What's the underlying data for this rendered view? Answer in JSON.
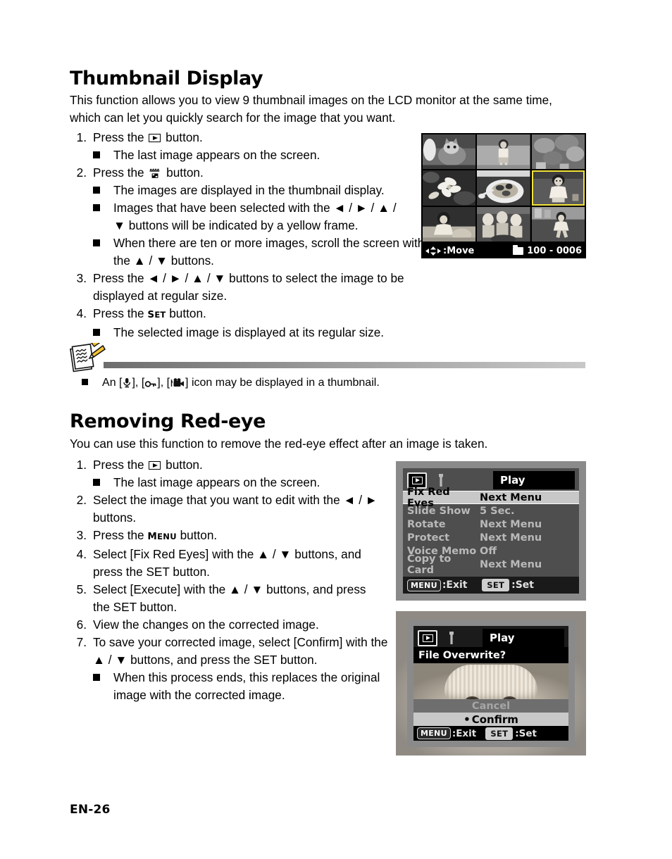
{
  "page": {
    "footer_label": "EN-26"
  },
  "section1": {
    "heading": "Thumbnail Display",
    "intro": "This function allows you to view 9 thumbnail images on the LCD monitor at the same time, which can let you quickly search for the image that you want.",
    "steps": [
      {
        "num": "1.",
        "pre": "Press the",
        "icon": "play-button-icon",
        "post": "button."
      },
      {
        "num": "2.",
        "pre": "Press the",
        "icon": "thumbnail-button-icon",
        "post": "button."
      },
      {
        "num": "3.",
        "text": "Press the ◄ / ► / ▲ / ▼ buttons to select the image to be displayed at regular size."
      },
      {
        "num": "4.",
        "pre": "Press the",
        "icon": "set-button-icon",
        "post": "button."
      }
    ],
    "bullets": {
      "b1": "The last image appears on the screen.",
      "b2": "The images are displayed in the thumbnail display.",
      "b3": "Images that have been selected with the ◄ / ► / ▲ / ▼ buttons will be indicated by a yellow frame.",
      "b4": "When there are ten or more images, scroll the screen with the ▲ / ▼ buttons.",
      "b5": "The selected image is displayed at its regular size."
    }
  },
  "note": {
    "text_before": "An [",
    "text_mid1": "], [",
    "text_mid2": "], [",
    "text_after": "] icon may be displayed in a thumbnail.",
    "icons": [
      "microphone-icon",
      "key-lock-icon",
      "video-camera-icon"
    ],
    "full_text": "An [mic], [key], [video] icon may be displayed in a thumbnail."
  },
  "section2": {
    "heading": "Removing Red-eye",
    "intro": "You can use this function to remove the red-eye effect after an image is taken.",
    "steps": [
      {
        "num": "1.",
        "pre": "Press the",
        "icon": "play-button-icon",
        "post": "button."
      },
      {
        "num": "2.",
        "text": "Select the image that you want to edit with the ◄ / ► buttons."
      },
      {
        "num": "3.",
        "pre": "Press the",
        "icon": "menu-button-icon",
        "post": "button."
      },
      {
        "num": "4.",
        "text": "Select [Fix Red Eyes] with the ▲ / ▼ buttons, and press the SET button."
      },
      {
        "num": "5.",
        "text": "Select [Execute] with the ▲ / ▼ buttons, and press the SET button."
      },
      {
        "num": "6.",
        "text": "View the changes on the corrected image."
      },
      {
        "num": "7.",
        "text": "To save your corrected image, select [Confirm] with the ▲ / ▼ buttons, and press the SET button."
      }
    ],
    "bullets": {
      "b1": "The last image appears on the screen.",
      "b2": "When this process ends, this replaces the original image with the corrected image."
    }
  },
  "thumbnail_screen": {
    "move_label": ":Move",
    "file_number": "100 - 0006",
    "selected_index": 5,
    "cells": [
      "cat-photo",
      "girl-standing-photo",
      "plants-photo",
      "flowers-photo",
      "food-plate-photo",
      "child-on-grass-photo",
      "girl-sitting-photo",
      "children-group-photo",
      "boy-running-photo"
    ]
  },
  "play_menu_screen": {
    "tabs": [
      "play-tab",
      "setup-tab"
    ],
    "title": "Play",
    "rows": [
      {
        "label": "Fix Red Eyes",
        "value": "Next Menu",
        "highlighted": true
      },
      {
        "label": "Slide Show",
        "value": "5 Sec.",
        "highlighted": false
      },
      {
        "label": "Rotate",
        "value": "Next Menu",
        "highlighted": false
      },
      {
        "label": "Protect",
        "value": "Next Menu",
        "highlighted": false
      },
      {
        "label": "Voice Memo",
        "value": "Off",
        "highlighted": false
      },
      {
        "label": "Copy to Card",
        "value": "Next Menu",
        "highlighted": false
      }
    ],
    "menu_badge": "MENU",
    "menu_action": ":Exit",
    "set_badge": "SET",
    "set_action": ":Set"
  },
  "overwrite_screen": {
    "title": "Play",
    "prompt": "File Overwrite?",
    "option_cancel": "Cancel",
    "option_confirm": "Confirm",
    "selected_option": "Confirm",
    "menu_badge": "MENU",
    "menu_action": ":Exit",
    "set_badge": "SET",
    "set_action": ":Set"
  },
  "colors": {
    "selection_frame": "#f2e23a",
    "highlight_row": "#c8c8c8",
    "lcd_background": "#4e4e4e",
    "bezel": "#8a8a8a"
  }
}
